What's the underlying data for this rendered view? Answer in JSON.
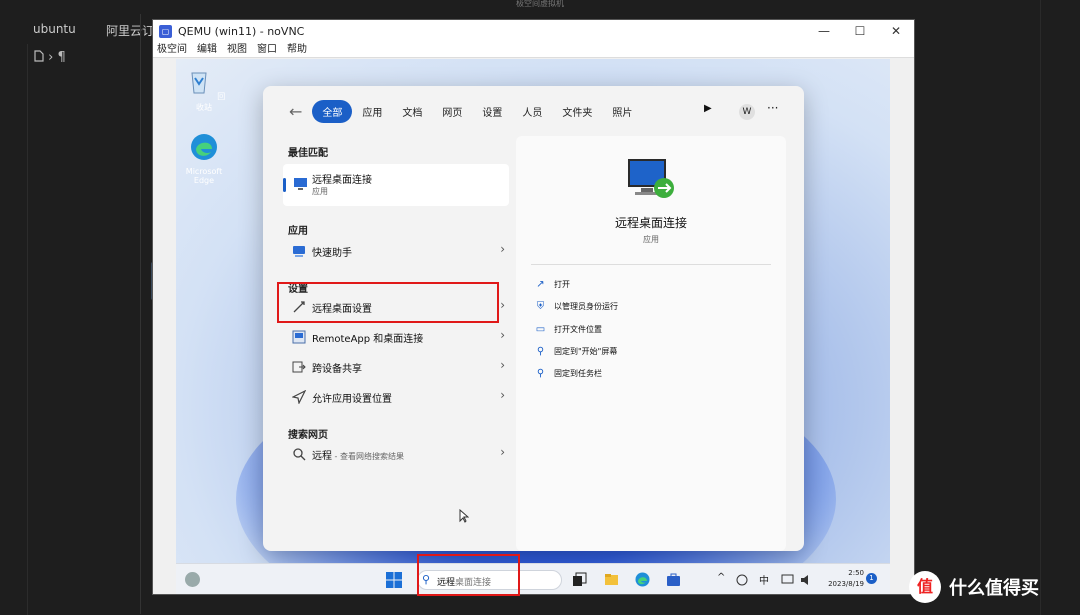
{
  "host": {
    "window_title": "极空间虚拟机",
    "tabs": [
      "ubuntu",
      "阿里云订"
    ],
    "crumb_glyph": "›",
    "crumb_text": "¶",
    "side_handle": "▸"
  },
  "vnc": {
    "title": "QEMU (win11) - noVNC",
    "icon_glyph": "▢",
    "controls": [
      "—",
      "☐",
      "✕"
    ],
    "menu": [
      "极空间",
      "编辑",
      "视图",
      "窗口",
      "帮助"
    ]
  },
  "desktop": {
    "icons": [
      {
        "label": "回收站"
      },
      {
        "label": "Microsoft Edge"
      }
    ]
  },
  "start": {
    "back": "←",
    "filters": [
      "全部",
      "应用",
      "文档",
      "网页",
      "设置",
      "人员",
      "文件夹",
      "照片"
    ],
    "play": "▶",
    "avatar": "W",
    "more": "···",
    "best_match_heading": "最佳匹配",
    "best_match": {
      "title": "远程桌面连接",
      "subtitle": "应用"
    },
    "apps_heading": "应用",
    "apps": [
      {
        "label": "快速助手"
      }
    ],
    "settings_heading": "设置",
    "settings": [
      {
        "label": "远程桌面设置"
      },
      {
        "label": "RemoteApp 和桌面连接"
      },
      {
        "label": "跨设备共享"
      },
      {
        "label": "允许应用设置位置"
      }
    ],
    "web_heading": "搜索网页",
    "web": {
      "label": "远程",
      "sub": " - 查看网络搜索结果"
    },
    "chevron": "›",
    "detail": {
      "title": "远程桌面连接",
      "subtitle": "应用",
      "actions": [
        {
          "label": "打开",
          "icon": "↗"
        },
        {
          "label": "以管理员身份运行",
          "icon": "⛨"
        },
        {
          "label": "打开文件位置",
          "icon": "▭"
        },
        {
          "label": "固定到\"开始\"屏幕",
          "icon": "⚲"
        },
        {
          "label": "固定到任务栏",
          "icon": "⚲"
        }
      ]
    }
  },
  "taskbar": {
    "search_query": "远程",
    "search_hint": "桌面连接",
    "search_icon": "⚲",
    "tray": {
      "chevron": "^",
      "ime": "中"
    },
    "time": "2:50",
    "date": "2023/8/19",
    "notifications": "1"
  },
  "watermark": {
    "logo": "值",
    "text": "什么值得买"
  },
  "colors": {
    "accent": "#1b5fc7",
    "highlight_box": "#e01818"
  }
}
